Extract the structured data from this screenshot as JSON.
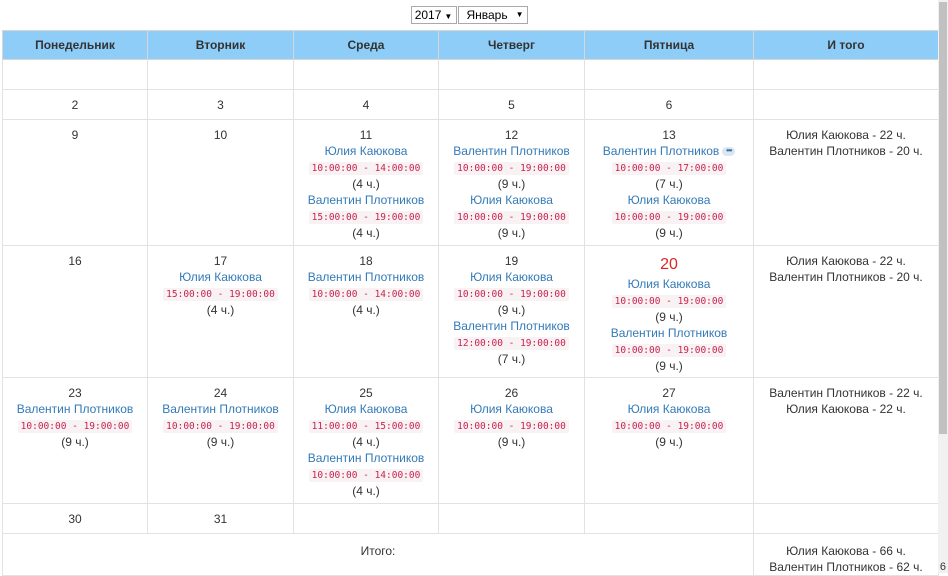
{
  "controls": {
    "year": "2017",
    "month": "Январь"
  },
  "headers": [
    "Понедельник",
    "Вторник",
    "Среда",
    "Четверг",
    "Пятница",
    "И того"
  ],
  "rows": [
    {
      "cells": [
        {
          "day": "",
          "entries": []
        },
        {
          "day": "",
          "entries": []
        },
        {
          "day": "",
          "entries": []
        },
        {
          "day": "",
          "entries": []
        },
        {
          "day": "",
          "entries": []
        }
      ],
      "totals": []
    },
    {
      "cells": [
        {
          "day": "2",
          "entries": []
        },
        {
          "day": "3",
          "entries": []
        },
        {
          "day": "4",
          "entries": []
        },
        {
          "day": "5",
          "entries": []
        },
        {
          "day": "6",
          "entries": []
        }
      ],
      "totals": []
    },
    {
      "cells": [
        {
          "day": "9",
          "entries": []
        },
        {
          "day": "10",
          "entries": []
        },
        {
          "day": "11",
          "entries": [
            {
              "name": "Юлия Каюкова",
              "time": "10:00:00 - 14:00:00",
              "dur": "(4 ч.)"
            },
            {
              "name": "Валентин Плотников",
              "time": "15:00:00 - 19:00:00",
              "dur": "(4 ч.)"
            }
          ]
        },
        {
          "day": "12",
          "entries": [
            {
              "name": "Валентин Плотников",
              "time": "10:00:00 - 19:00:00",
              "dur": "(9 ч.)"
            },
            {
              "name": "Юлия Каюкова",
              "time": "10:00:00 - 19:00:00",
              "dur": "(9 ч.)"
            }
          ]
        },
        {
          "day": "13",
          "entries": [
            {
              "name": "Валентин Плотников",
              "time": "10:00:00 - 17:00:00",
              "dur": "(7 ч.)",
              "more": "•••"
            },
            {
              "name": "Юлия Каюкова",
              "time": "10:00:00 - 19:00:00",
              "dur": "(9 ч.)"
            }
          ]
        }
      ],
      "totals": [
        "Юлия Каюкова - 22 ч.",
        "Валентин Плотников - 20 ч."
      ]
    },
    {
      "cells": [
        {
          "day": "16",
          "entries": []
        },
        {
          "day": "17",
          "entries": [
            {
              "name": "Юлия Каюкова",
              "time": "15:00:00 - 19:00:00",
              "dur": "(4 ч.)"
            }
          ]
        },
        {
          "day": "18",
          "entries": [
            {
              "name": "Валентин Плотников",
              "time": "10:00:00 - 14:00:00",
              "dur": "(4 ч.)"
            }
          ]
        },
        {
          "day": "19",
          "entries": [
            {
              "name": "Юлия Каюкова",
              "time": "10:00:00 - 19:00:00",
              "dur": "(9 ч.)"
            },
            {
              "name": "Валентин Плотников",
              "time": "12:00:00 - 19:00:00",
              "dur": "(7 ч.)"
            }
          ]
        },
        {
          "day": "20",
          "today": true,
          "entries": [
            {
              "name": "Юлия Каюкова",
              "time": "10:00:00 - 19:00:00",
              "dur": "(9 ч.)"
            },
            {
              "name": "Валентин Плотников",
              "time": "10:00:00 - 19:00:00",
              "dur": "(9 ч.)"
            }
          ]
        }
      ],
      "totals": [
        "Юлия Каюкова - 22 ч.",
        "Валентин Плотников - 20 ч."
      ]
    },
    {
      "cells": [
        {
          "day": "23",
          "entries": [
            {
              "name": "Валентин Плотников",
              "time": "10:00:00 - 19:00:00",
              "dur": "(9 ч.)"
            }
          ]
        },
        {
          "day": "24",
          "entries": [
            {
              "name": "Валентин Плотников",
              "time": "10:00:00 - 19:00:00",
              "dur": "(9 ч.)"
            }
          ]
        },
        {
          "day": "25",
          "entries": [
            {
              "name": "Юлия Каюкова",
              "time": "11:00:00 - 15:00:00",
              "dur": "(4 ч.)"
            },
            {
              "name": "Валентин Плотников",
              "time": "10:00:00 - 14:00:00",
              "dur": "(4 ч.)"
            }
          ]
        },
        {
          "day": "26",
          "entries": [
            {
              "name": "Юлия Каюкова",
              "time": "10:00:00 - 19:00:00",
              "dur": "(9 ч.)"
            }
          ]
        },
        {
          "day": "27",
          "entries": [
            {
              "name": "Юлия Каюкова",
              "time": "10:00:00 - 19:00:00",
              "dur": "(9 ч.)"
            }
          ]
        }
      ],
      "totals": [
        "Валентин Плотников - 22 ч.",
        "Юлия Каюкова - 22 ч."
      ]
    },
    {
      "cells": [
        {
          "day": "30",
          "entries": []
        },
        {
          "day": "31",
          "entries": []
        },
        {
          "day": "",
          "entries": []
        },
        {
          "day": "",
          "entries": []
        },
        {
          "day": "",
          "entries": []
        }
      ],
      "totals": []
    }
  ],
  "summary": {
    "label": "Итого:",
    "totals": [
      "Юлия Каюкова - 66 ч.",
      "Валентин Плотников - 62 ч."
    ]
  },
  "edge_text": "6"
}
